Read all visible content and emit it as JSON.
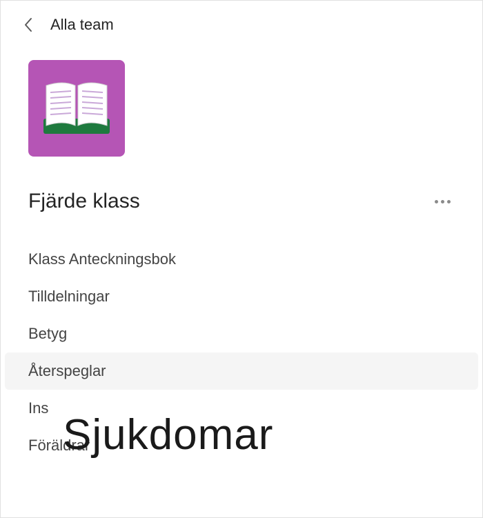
{
  "header": {
    "back_label": "Alla team"
  },
  "team": {
    "title": "Fjärde klass",
    "icon_name": "book-icon"
  },
  "nav": {
    "items": [
      {
        "label": "Klass  Anteckningsbok"
      },
      {
        "label": "Tilldelningar"
      },
      {
        "label": "Betyg"
      },
      {
        "label": "Återspeglar"
      },
      {
        "label": "Ins"
      },
      {
        "label": "Föräldrar"
      }
    ],
    "selected_index": 3
  },
  "overlay": {
    "text": "Sjukdomar"
  }
}
